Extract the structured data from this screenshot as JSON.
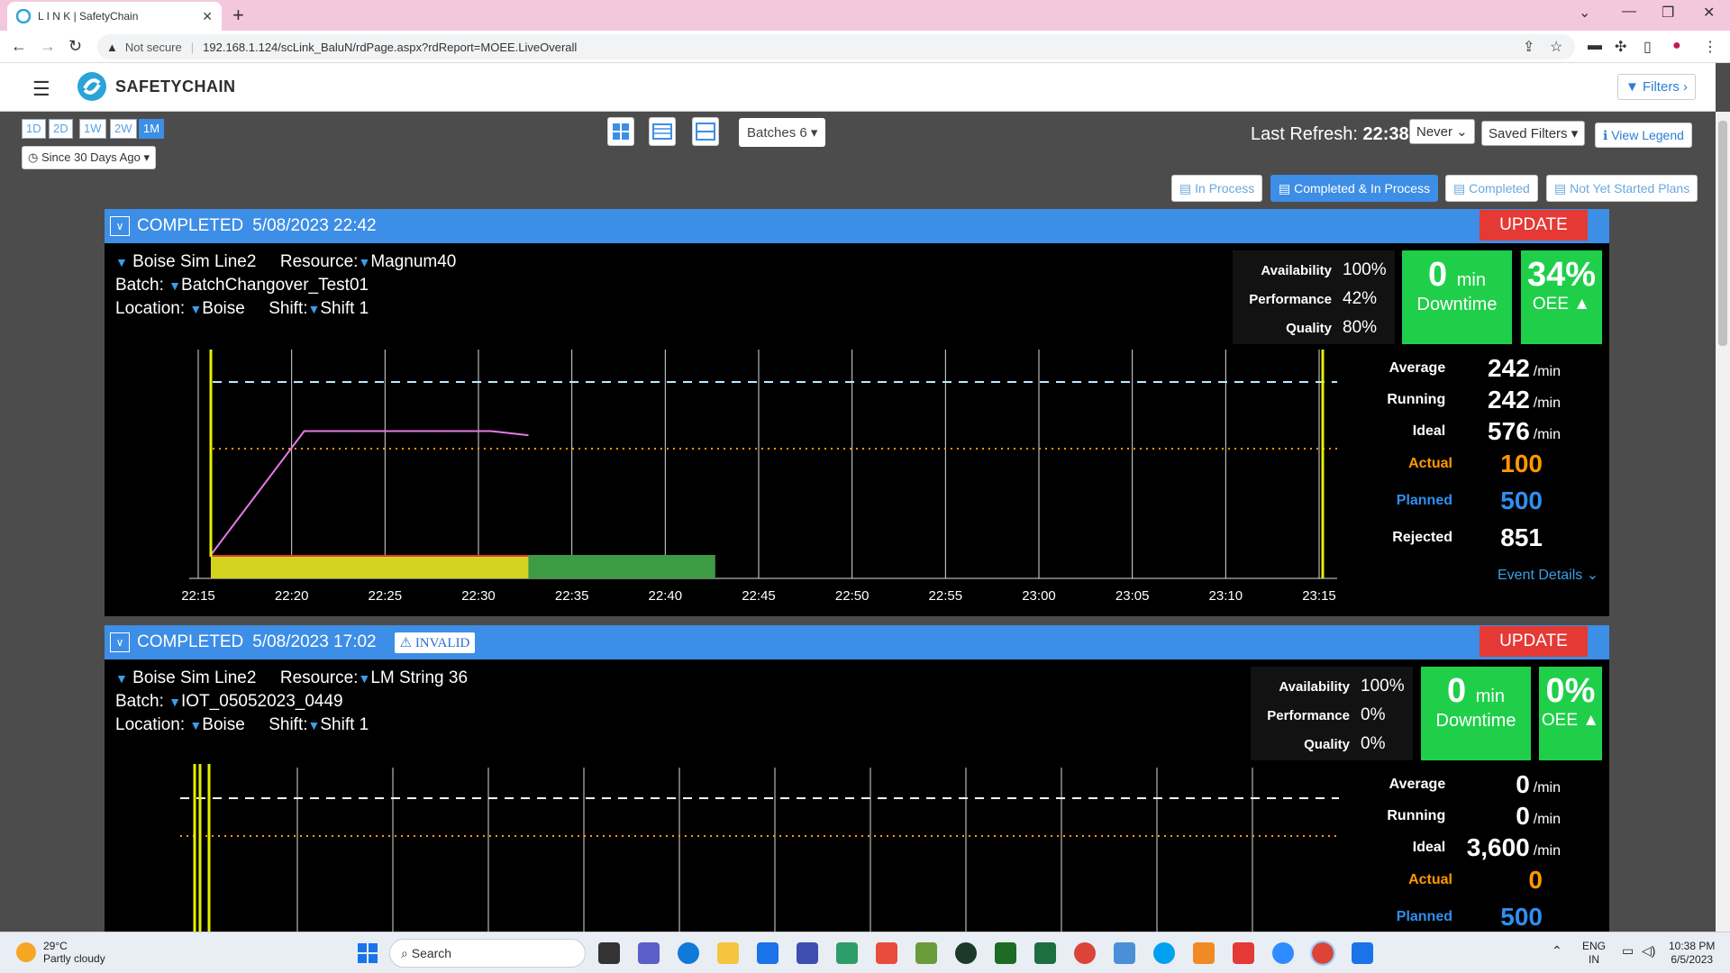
{
  "browser": {
    "tab_title": "L I N K | SafetyChain",
    "not_secure": "Not secure",
    "url": "192.168.1.124/scLink_BaluN/rdPage.aspx?rdReport=MOEE.LiveOverall",
    "icons": [
      "back-icon",
      "forward-icon",
      "reload-icon",
      "share-icon",
      "star-icon",
      "puzzle-icon",
      "profile-icon",
      "menu-icon"
    ]
  },
  "app": {
    "logo_text": "SAFETYCHAIN",
    "filters_label": "Filters",
    "ranges": [
      "1D",
      "2D",
      "1W",
      "2W",
      "1M"
    ],
    "active_range": "1M",
    "since_label": "Since 30 Days Ago",
    "batches_label": "Batches 6",
    "last_refresh_label": "Last Refresh:",
    "last_refresh_time": "22:38",
    "refresh_select": "Never",
    "saved_filters": "Saved Filters",
    "view_legend": "View Legend",
    "modes": [
      "In Process",
      "Completed & In Process",
      "Completed",
      "Not Yet Started Plans"
    ],
    "active_mode": "Completed & In Process"
  },
  "cards": [
    {
      "status": "COMPLETED",
      "date": "5/08/2023 22:42",
      "invalid": "",
      "update": "UPDATE",
      "line": "Boise Sim Line2",
      "resource_label": "Resource:",
      "resource": "Magnum40",
      "batch_label": "Batch:",
      "batch": "BatchChangover_Test01",
      "location_label": "Location:",
      "location": "Boise",
      "shift_label": "Shift:",
      "shift": "Shift 1",
      "availability_label": "Availability",
      "availability": "100%",
      "performance_label": "Performance",
      "performance": "42%",
      "quality_label": "Quality",
      "quality": "80%",
      "downtime_value": "0",
      "downtime_unit": "min",
      "downtime_label": "Downtime",
      "oee_value": "34%",
      "oee_label": "OEE",
      "average_label": "Average",
      "average": "242",
      "running_label": "Running",
      "running": "242",
      "ideal_label": "Ideal",
      "ideal": "576",
      "actual_label": "Actual",
      "actual": "100",
      "planned_label": "Planned",
      "planned": "500",
      "rejected_label": "Rejected",
      "rejected": "851",
      "rate_unit": "/min",
      "event_details": "Event Details"
    },
    {
      "status": "COMPLETED",
      "date": "5/08/2023 17:02",
      "invalid": "INVALID",
      "update": "UPDATE",
      "line": "Boise Sim Line2",
      "resource_label": "Resource:",
      "resource": "LM String 36",
      "batch_label": "Batch:",
      "batch": "IOT_05052023_0449",
      "location_label": "Location:",
      "location": "Boise",
      "shift_label": "Shift:",
      "shift": "Shift 1",
      "availability_label": "Availability",
      "availability": "100%",
      "performance_label": "Performance",
      "performance": "0%",
      "quality_label": "Quality",
      "quality": "0%",
      "downtime_value": "0",
      "downtime_unit": "min",
      "downtime_label": "Downtime",
      "oee_value": "0%",
      "oee_label": "OEE",
      "average_label": "Average",
      "average": "0",
      "running_label": "Running",
      "running": "0",
      "ideal_label": "Ideal",
      "ideal": "3,600",
      "actual_label": "Actual",
      "actual": "0",
      "planned_label": "Planned",
      "planned": "500",
      "rate_unit": "/min"
    }
  ],
  "chart_data": {
    "type": "line",
    "x_ticks": [
      "22:15",
      "22:20",
      "22:25",
      "22:30",
      "22:35",
      "22:40",
      "22:45",
      "22:50",
      "22:55",
      "23:00",
      "23:05",
      "23:10",
      "23:15"
    ],
    "series": [
      {
        "color": "#e878e8",
        "points": [
          [
            "22:15",
            0.0
          ],
          [
            "22:20",
            0.6
          ],
          [
            "22:25",
            0.6
          ],
          [
            "22:30",
            0.6
          ],
          [
            "22:32",
            0.58
          ]
        ]
      }
    ],
    "state_bar": [
      {
        "from": "22:15",
        "to": "22:32",
        "color": "#d4d420"
      },
      {
        "from": "22:32",
        "to": "22:42",
        "color": "#3d9a45"
      }
    ]
  },
  "chart2_data": {
    "type": "line",
    "x_ticks": []
  },
  "taskbar": {
    "temperature": "29°C",
    "condition": "Partly cloudy",
    "search": "Search",
    "lang1": "ENG",
    "lang2": "IN",
    "time": "10:38 PM",
    "date": "6/5/2023"
  }
}
